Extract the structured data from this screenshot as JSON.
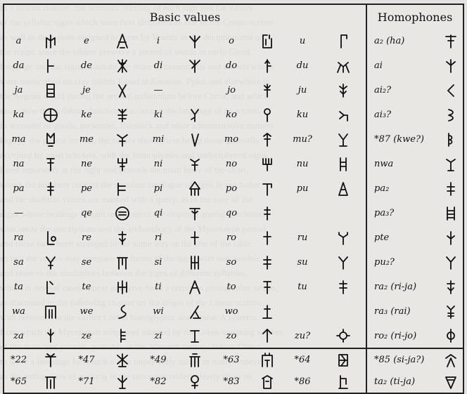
{
  "headers": {
    "basic": "Basic values",
    "homophones": "Homophones"
  },
  "basic_rows": [
    [
      "a",
      "e",
      "i",
      "o",
      "u"
    ],
    [
      "da",
      "de",
      "di",
      "do",
      "du"
    ],
    [
      "ja",
      "je",
      "—",
      "jo",
      "ju"
    ],
    [
      "ka",
      "ke",
      "ki",
      "ko",
      "ku"
    ],
    [
      "ma",
      "me",
      "mi",
      "mo",
      "mu?"
    ],
    [
      "na",
      "ne",
      "ni",
      "no",
      "nu"
    ],
    [
      "pa",
      "pe",
      "pi",
      "po",
      "pu"
    ],
    [
      "—",
      "qe",
      "qi",
      "qo",
      ""
    ],
    [
      "ra",
      "re",
      "ri",
      "ro",
      "ru"
    ],
    [
      "sa",
      "se",
      "si",
      "so",
      "su"
    ],
    [
      "ta",
      "te",
      "ti",
      "to",
      "tu"
    ],
    [
      "wa",
      "we",
      "wi",
      "wo",
      ""
    ],
    [
      "za",
      "ze",
      "zi",
      "zo",
      "zu?"
    ]
  ],
  "homophones": [
    "a₂ (ha)",
    "ai",
    "ai₂?",
    "ai₃?",
    "*87 (kwe?)",
    "nwa",
    "pa₂",
    "pa₃?",
    "pte",
    "pu₂?",
    "ra₂ (ri-ja)",
    "ra₃ (rai)",
    "ro₂ (ri-jo)"
  ],
  "numbered_rows": [
    [
      "*22",
      "*47",
      "*49",
      "*63",
      "*64"
    ],
    [
      "*65",
      "*71",
      "*82",
      "*83",
      "*86"
    ]
  ],
  "numbered_homophones": [
    "*85 (si-ja?)",
    "ta₂ (ti-ja)"
  ]
}
